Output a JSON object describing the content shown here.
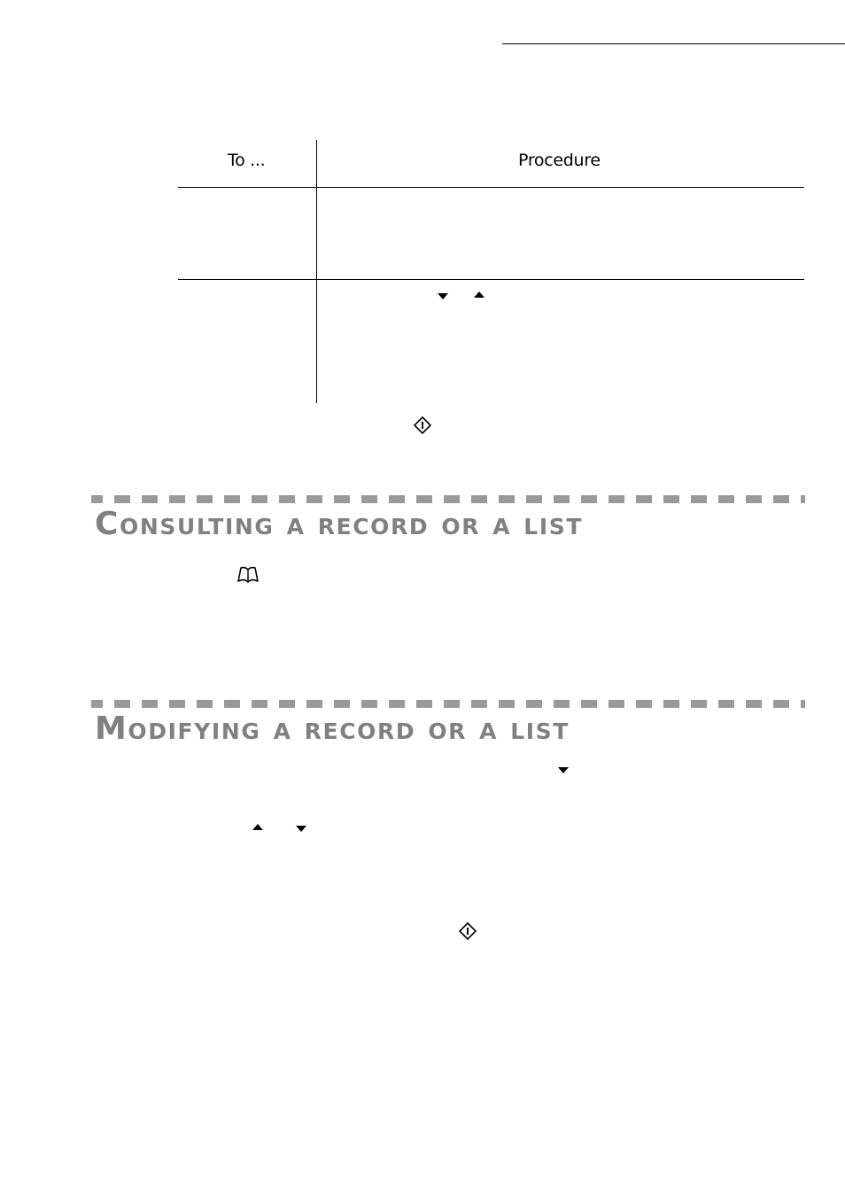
{
  "page": {
    "table": {
      "headers": [
        "To ...",
        "Procedure"
      ],
      "rows": [
        {
          "to": "",
          "procedure": "",
          "icons": []
        },
        {
          "to": "",
          "procedure": "",
          "icons": [
            "arrow-down",
            "arrow-up"
          ]
        }
      ]
    },
    "after_table_icon": "start-key",
    "sections": [
      {
        "title": "Consulting a record or a list",
        "icons": [
          "directory-book"
        ]
      },
      {
        "title": "Modifying a record or a list",
        "icons": [
          "arrow-down",
          "arrow-up",
          "arrow-down",
          "start-key"
        ]
      }
    ]
  }
}
